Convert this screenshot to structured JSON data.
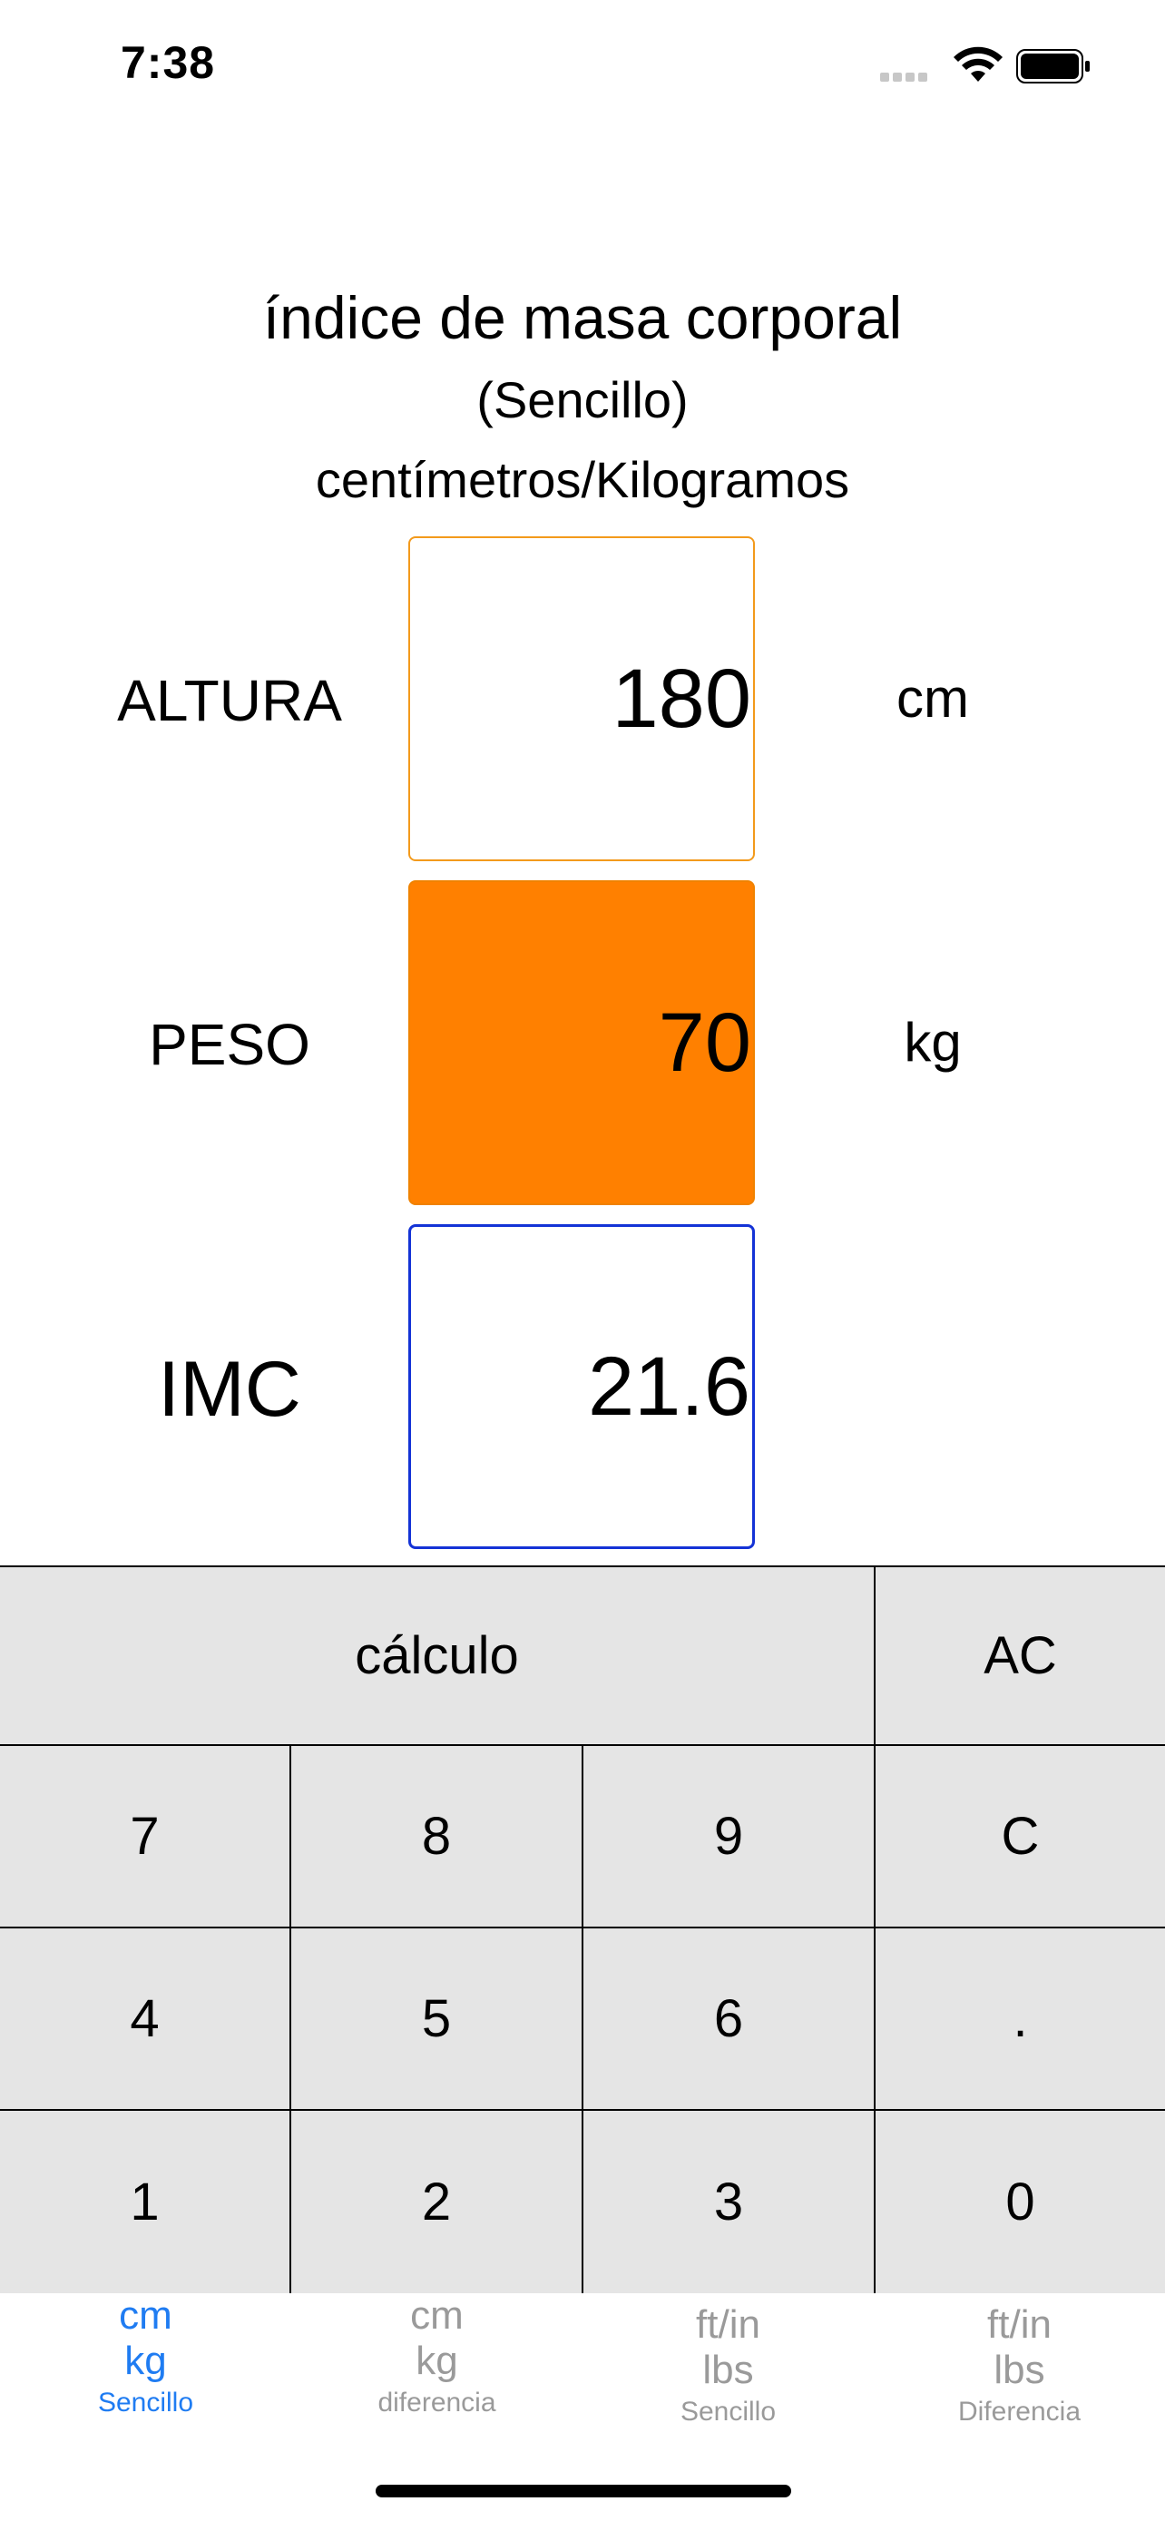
{
  "status_bar": {
    "time": "7:38"
  },
  "header": {
    "title": "índice de masa corporal",
    "subtitle": "(Sencillo)",
    "units": "centímetros/Kilogramos"
  },
  "fields": {
    "height": {
      "label": "ALTURA",
      "value": "180",
      "unit": "cm"
    },
    "weight": {
      "label": "PESO",
      "value": "70",
      "unit": "kg"
    },
    "bmi": {
      "label": "IMC",
      "value": "21.6"
    }
  },
  "keypad": {
    "calc": "cálculo",
    "ac": "AC",
    "k7": "7",
    "k8": "8",
    "k9": "9",
    "c": "C",
    "k4": "4",
    "k5": "5",
    "k6": "6",
    "dot": ".",
    "k1": "1",
    "k2": "2",
    "k3": "3",
    "k0": "0"
  },
  "tabs": [
    {
      "l1": "cm",
      "l2": "kg",
      "sub": "Sencillo"
    },
    {
      "l1": "cm",
      "l2": "kg",
      "sub": "diferencia"
    },
    {
      "l1": "ft/in",
      "l2": "lbs",
      "sub": "Sencillo"
    },
    {
      "l1": "ft/in",
      "l2": "lbs",
      "sub": "Diferencia"
    }
  ],
  "colors": {
    "accent": "#1f7cf2",
    "weight_fill": "#ff8000",
    "height_border": "#f39a1c",
    "bmi_border": "#1433d6",
    "keypad_bg": "#e5e5e5"
  }
}
